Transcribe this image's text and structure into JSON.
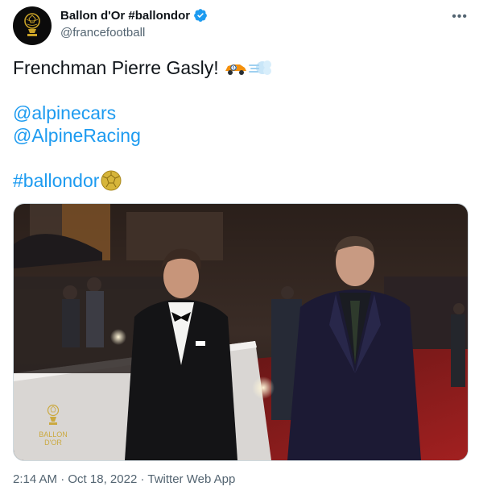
{
  "author": {
    "display_name": "Ballon d'Or #ballondor",
    "handle": "@francefootball",
    "verified": true
  },
  "tweet": {
    "text_line1": "Frenchman Pierre Gasly!",
    "mention1": "@alpinecars",
    "mention2": "@AlpineRacing",
    "hashtag": "#ballondor"
  },
  "media": {
    "watermark_line1": "BALLON",
    "watermark_line2": "D'OR"
  },
  "meta": {
    "time": "2:14 AM",
    "date": "Oct 18, 2022",
    "source": "Twitter Web App",
    "separator": "·"
  },
  "icons": {
    "verified": "verified-badge-icon",
    "more": "more-options-icon",
    "car": "race-car-emoji",
    "dash": "dash-emoji",
    "ball": "soccer-ball-emoji"
  },
  "colors": {
    "link": "#1d9bf0",
    "verified": "#1d9bf0",
    "secondary_text": "#536471",
    "primary_text": "#0f1419"
  }
}
